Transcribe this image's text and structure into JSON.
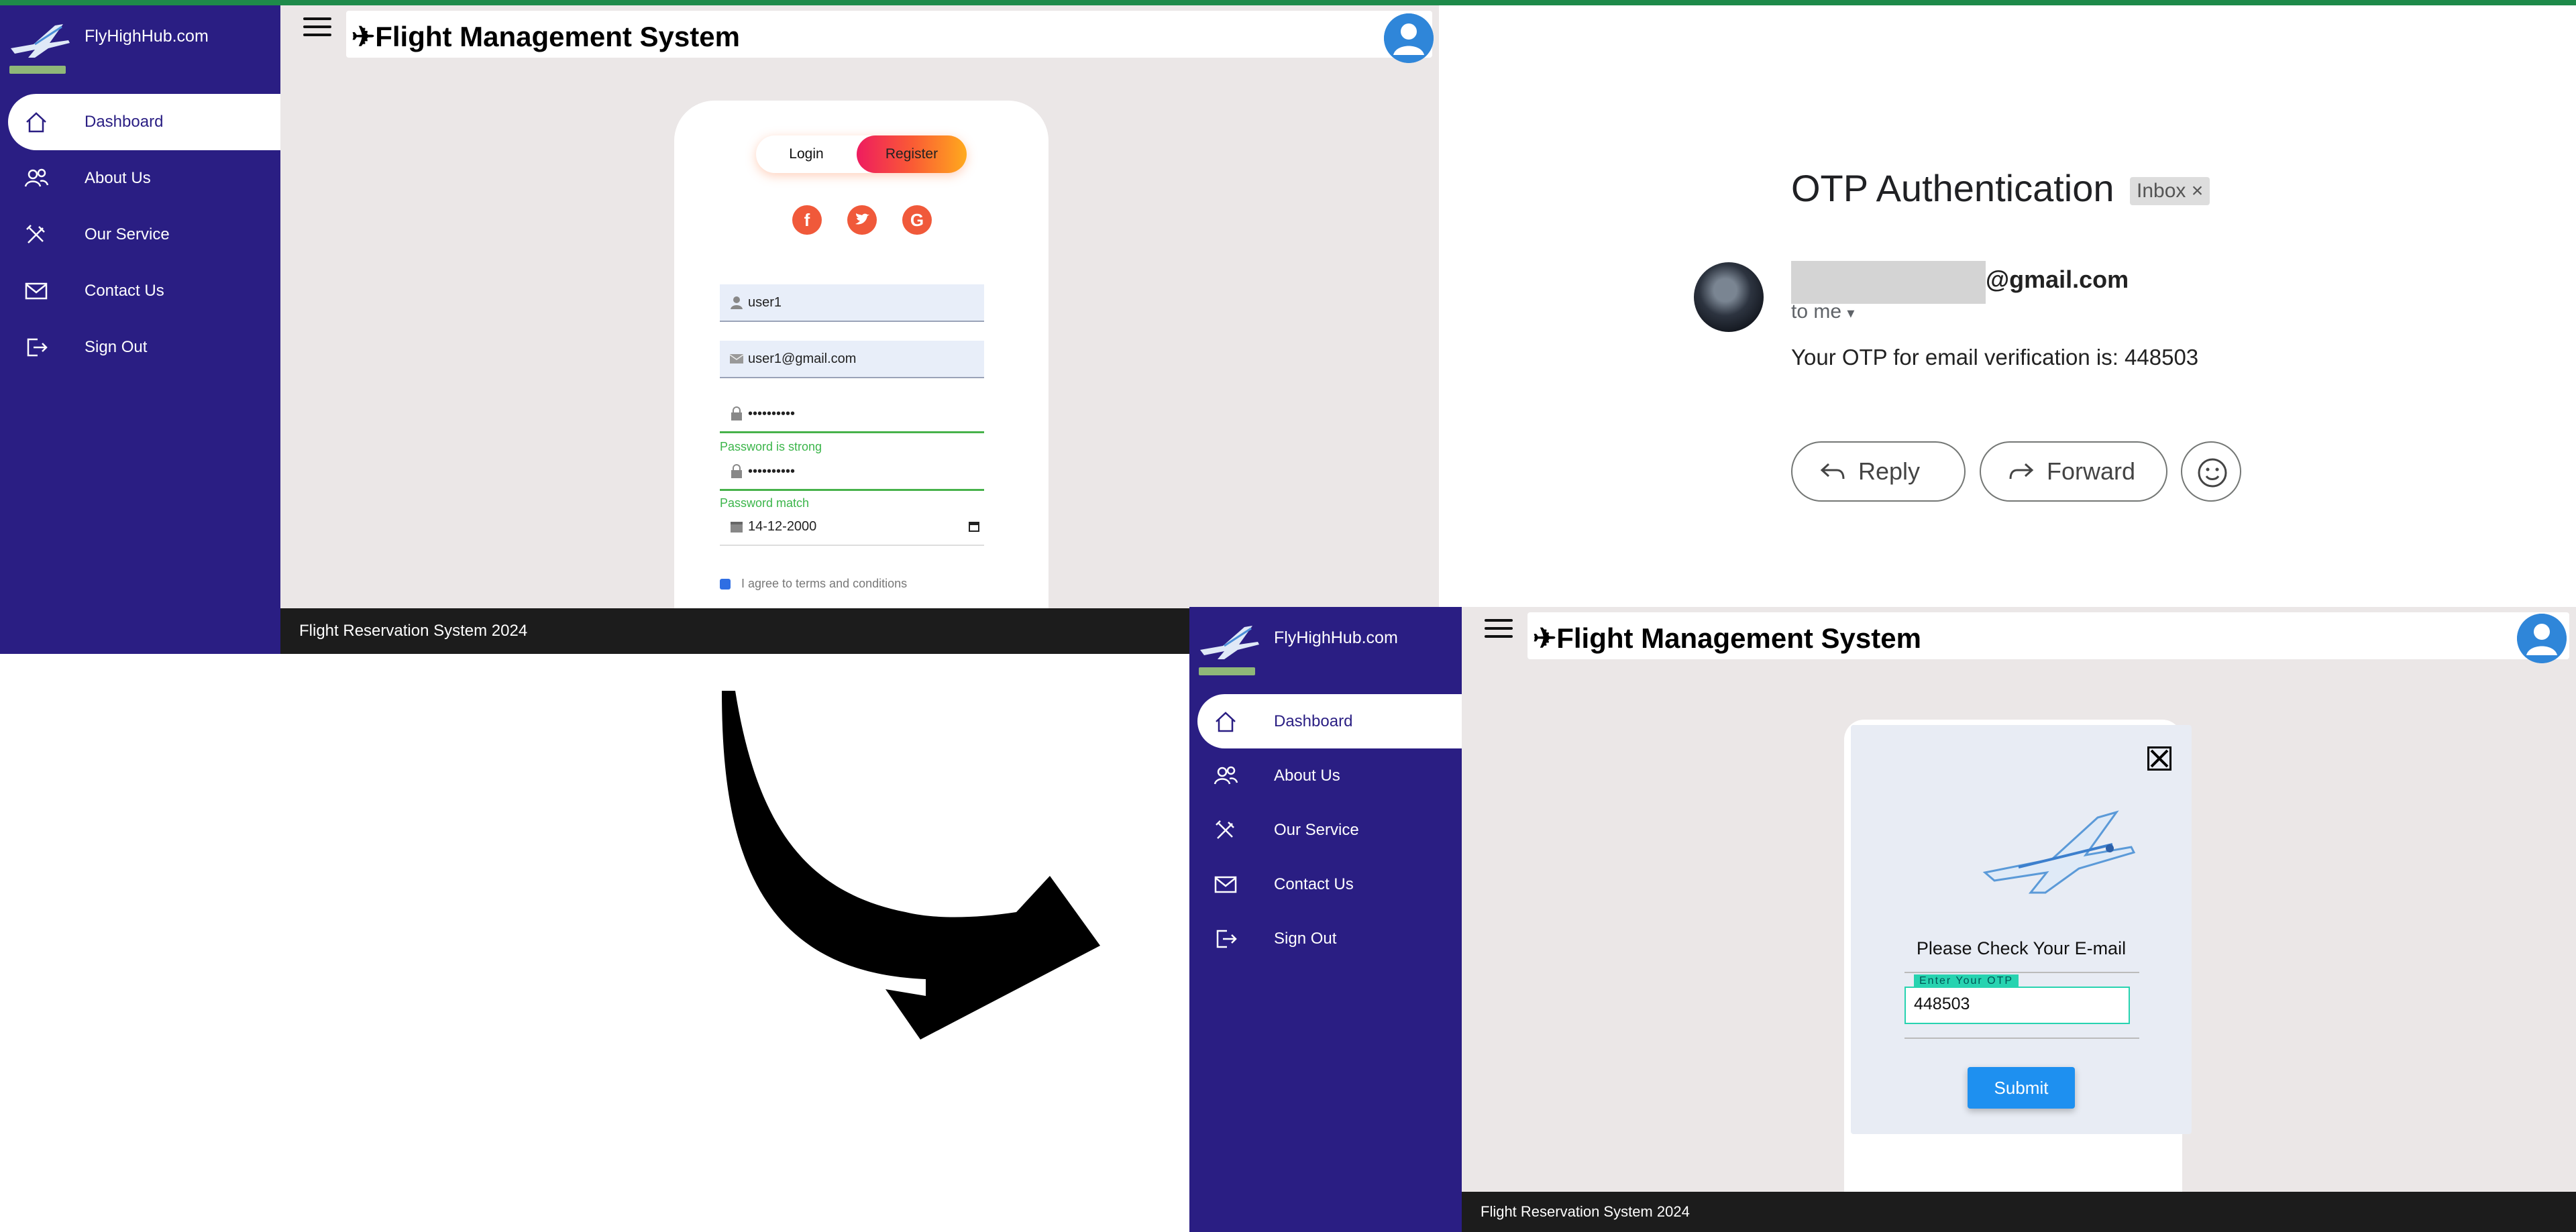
{
  "app_a": {
    "brand": "FlyHighHub.com",
    "title": "Flight Management System",
    "nav": [
      "Dashboard",
      "About Us",
      "Our Service",
      "Contact Us",
      "Sign Out"
    ],
    "tabs": {
      "login": "Login",
      "register": "Register"
    },
    "fields": {
      "username": "user1",
      "email": "user1@gmail.com",
      "password": "••••••••••",
      "password_hint": "Password is strong",
      "confirm_password": "••••••••••",
      "confirm_hint": "Password match",
      "dob": "14-12-2000"
    },
    "agree_text": "I agree to terms and conditions",
    "footer": "Flight Reservation System 2024"
  },
  "email": {
    "subject": "OTP Authentication",
    "tag": "Inbox ×",
    "sender_domain": "@gmail.com",
    "to_me": "to me",
    "body": "Your OTP for email verification is: 448503",
    "reply": "Reply",
    "forward": "Forward"
  },
  "app_b": {
    "brand": "FlyHighHub.com",
    "title": "Flight Management System",
    "nav": [
      "Dashboard",
      "About Us",
      "Our Service",
      "Contact Us",
      "Sign Out"
    ],
    "otp": {
      "message": "Please Check Your E-mail",
      "label": "Enter Your OTP",
      "value": "448503",
      "submit": "Submit"
    },
    "footer": "Flight Reservation System 2024"
  },
  "colors": {
    "sidebar": "#2a1e83",
    "accent_green": "#1e8a4a",
    "otp_teal": "#27d3b0",
    "submit_blue": "#1e90f0"
  }
}
